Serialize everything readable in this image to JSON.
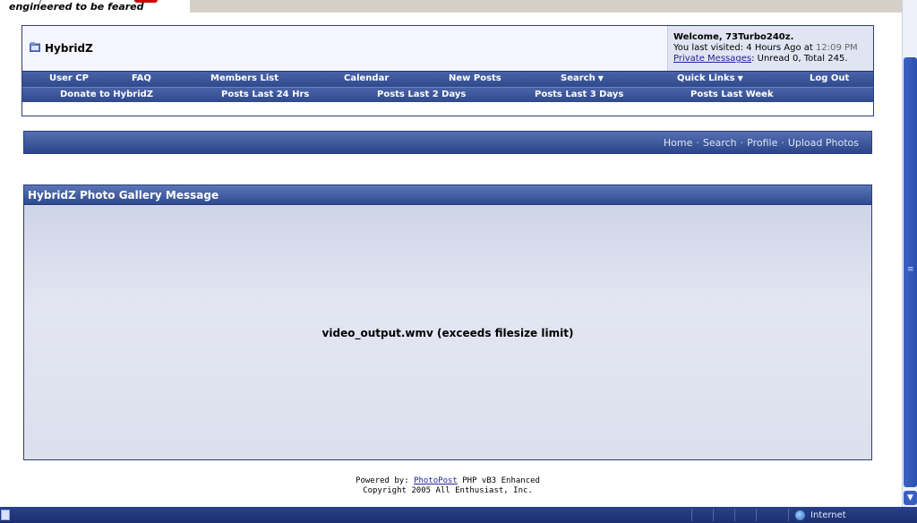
{
  "banner": {
    "tagline": "engineered to be feared"
  },
  "header": {
    "site_name": "HybridZ",
    "welcome": {
      "title": "Welcome, 73Turbo240z.",
      "last_visited_prefix": "You last visited: 4 Hours Ago at ",
      "last_visited_time": "12:09 PM",
      "pm_link": "Private Messages",
      "pm_status": ": Unread 0, Total 245."
    }
  },
  "nav": {
    "row1": [
      {
        "label": "User CP"
      },
      {
        "label": "FAQ"
      },
      {
        "label": "Members List"
      },
      {
        "label": "Calendar"
      },
      {
        "label": "New Posts"
      },
      {
        "label": "Search"
      },
      {
        "label": "Quick Links"
      },
      {
        "label": "Log Out"
      }
    ],
    "row2": [
      {
        "label": "Donate to HybridZ"
      },
      {
        "label": "Posts Last 24 Hrs"
      },
      {
        "label": "Posts Last 2 Days"
      },
      {
        "label": "Posts Last 3 Days"
      },
      {
        "label": "Posts Last Week"
      }
    ]
  },
  "subnav": {
    "links": [
      "Home",
      "Search",
      "Profile",
      "Upload Photos"
    ],
    "separator": "·"
  },
  "panel": {
    "title": "HybridZ Photo Gallery Message",
    "message": "video_output.wmv (exceeds filesize limit)"
  },
  "footer": {
    "powered_prefix": "Powered by: ",
    "powered_link": "PhotoPost",
    "powered_suffix": " PHP vB3 Enhanced",
    "copyright": "Copyright 2005 All Enthusiast, Inc."
  },
  "statusbar": {
    "zone": "Internet"
  },
  "icons": {
    "site": "folder-icon",
    "scroll_down": "chevron-down-icon",
    "zone": "globe-icon"
  },
  "colors": {
    "nav_blue": "#2f4a8c",
    "link": "#22229c",
    "panel_bg": "#dcdfed"
  }
}
